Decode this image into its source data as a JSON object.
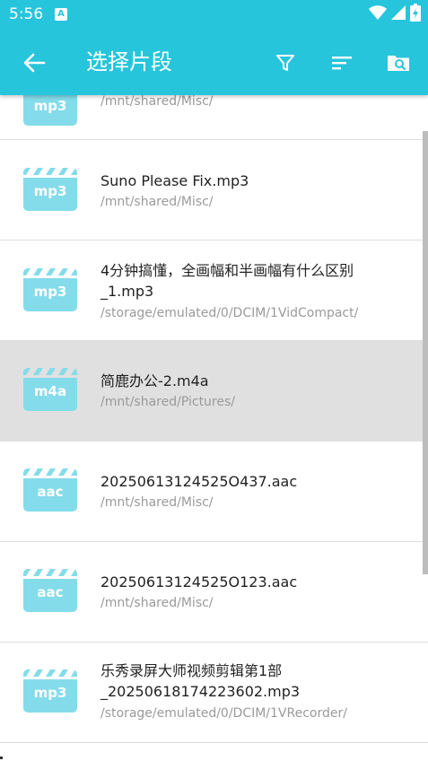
{
  "status_bar": {
    "time": "5:56",
    "notification_icon": "a-badge-icon",
    "icons": [
      "wifi-icon",
      "signal-icon",
      "battery-charging-icon"
    ]
  },
  "app_bar": {
    "title": "选择片段",
    "back_icon": "arrow-left-icon",
    "actions": [
      "filter-icon",
      "sort-icon",
      "folder-search-icon"
    ]
  },
  "colors": {
    "primary": "#27c5dc",
    "thumb": "#84dcea",
    "selected_row": "#e0e0e0",
    "divider": "#dddddd"
  },
  "files": [
    {
      "type": "mp3",
      "name": "",
      "path": "/mnt/shared/Misc/"
    },
    {
      "type": "mp3",
      "name": "Suno Please Fix.mp3",
      "path": "/mnt/shared/Misc/"
    },
    {
      "type": "mp3",
      "name": "4分钟搞懂，全画幅和半画幅有什么区别_1.mp3",
      "path": "/storage/emulated/0/DCIM/1VidCompact/"
    },
    {
      "type": "m4a",
      "name": "简鹿办公-2.m4a",
      "path": "/mnt/shared/Pictures/",
      "selected": true
    },
    {
      "type": "aac",
      "name": "20250613124525O437.aac",
      "path": "/mnt/shared/Misc/"
    },
    {
      "type": "aac",
      "name": "20250613124525O123.aac",
      "path": "/mnt/shared/Misc/"
    },
    {
      "type": "mp3",
      "name": "乐秀录屏大师视频剪辑第1部_20250618174223602.mp3",
      "path": "/storage/emulated/0/DCIM/1VRecorder/"
    }
  ]
}
